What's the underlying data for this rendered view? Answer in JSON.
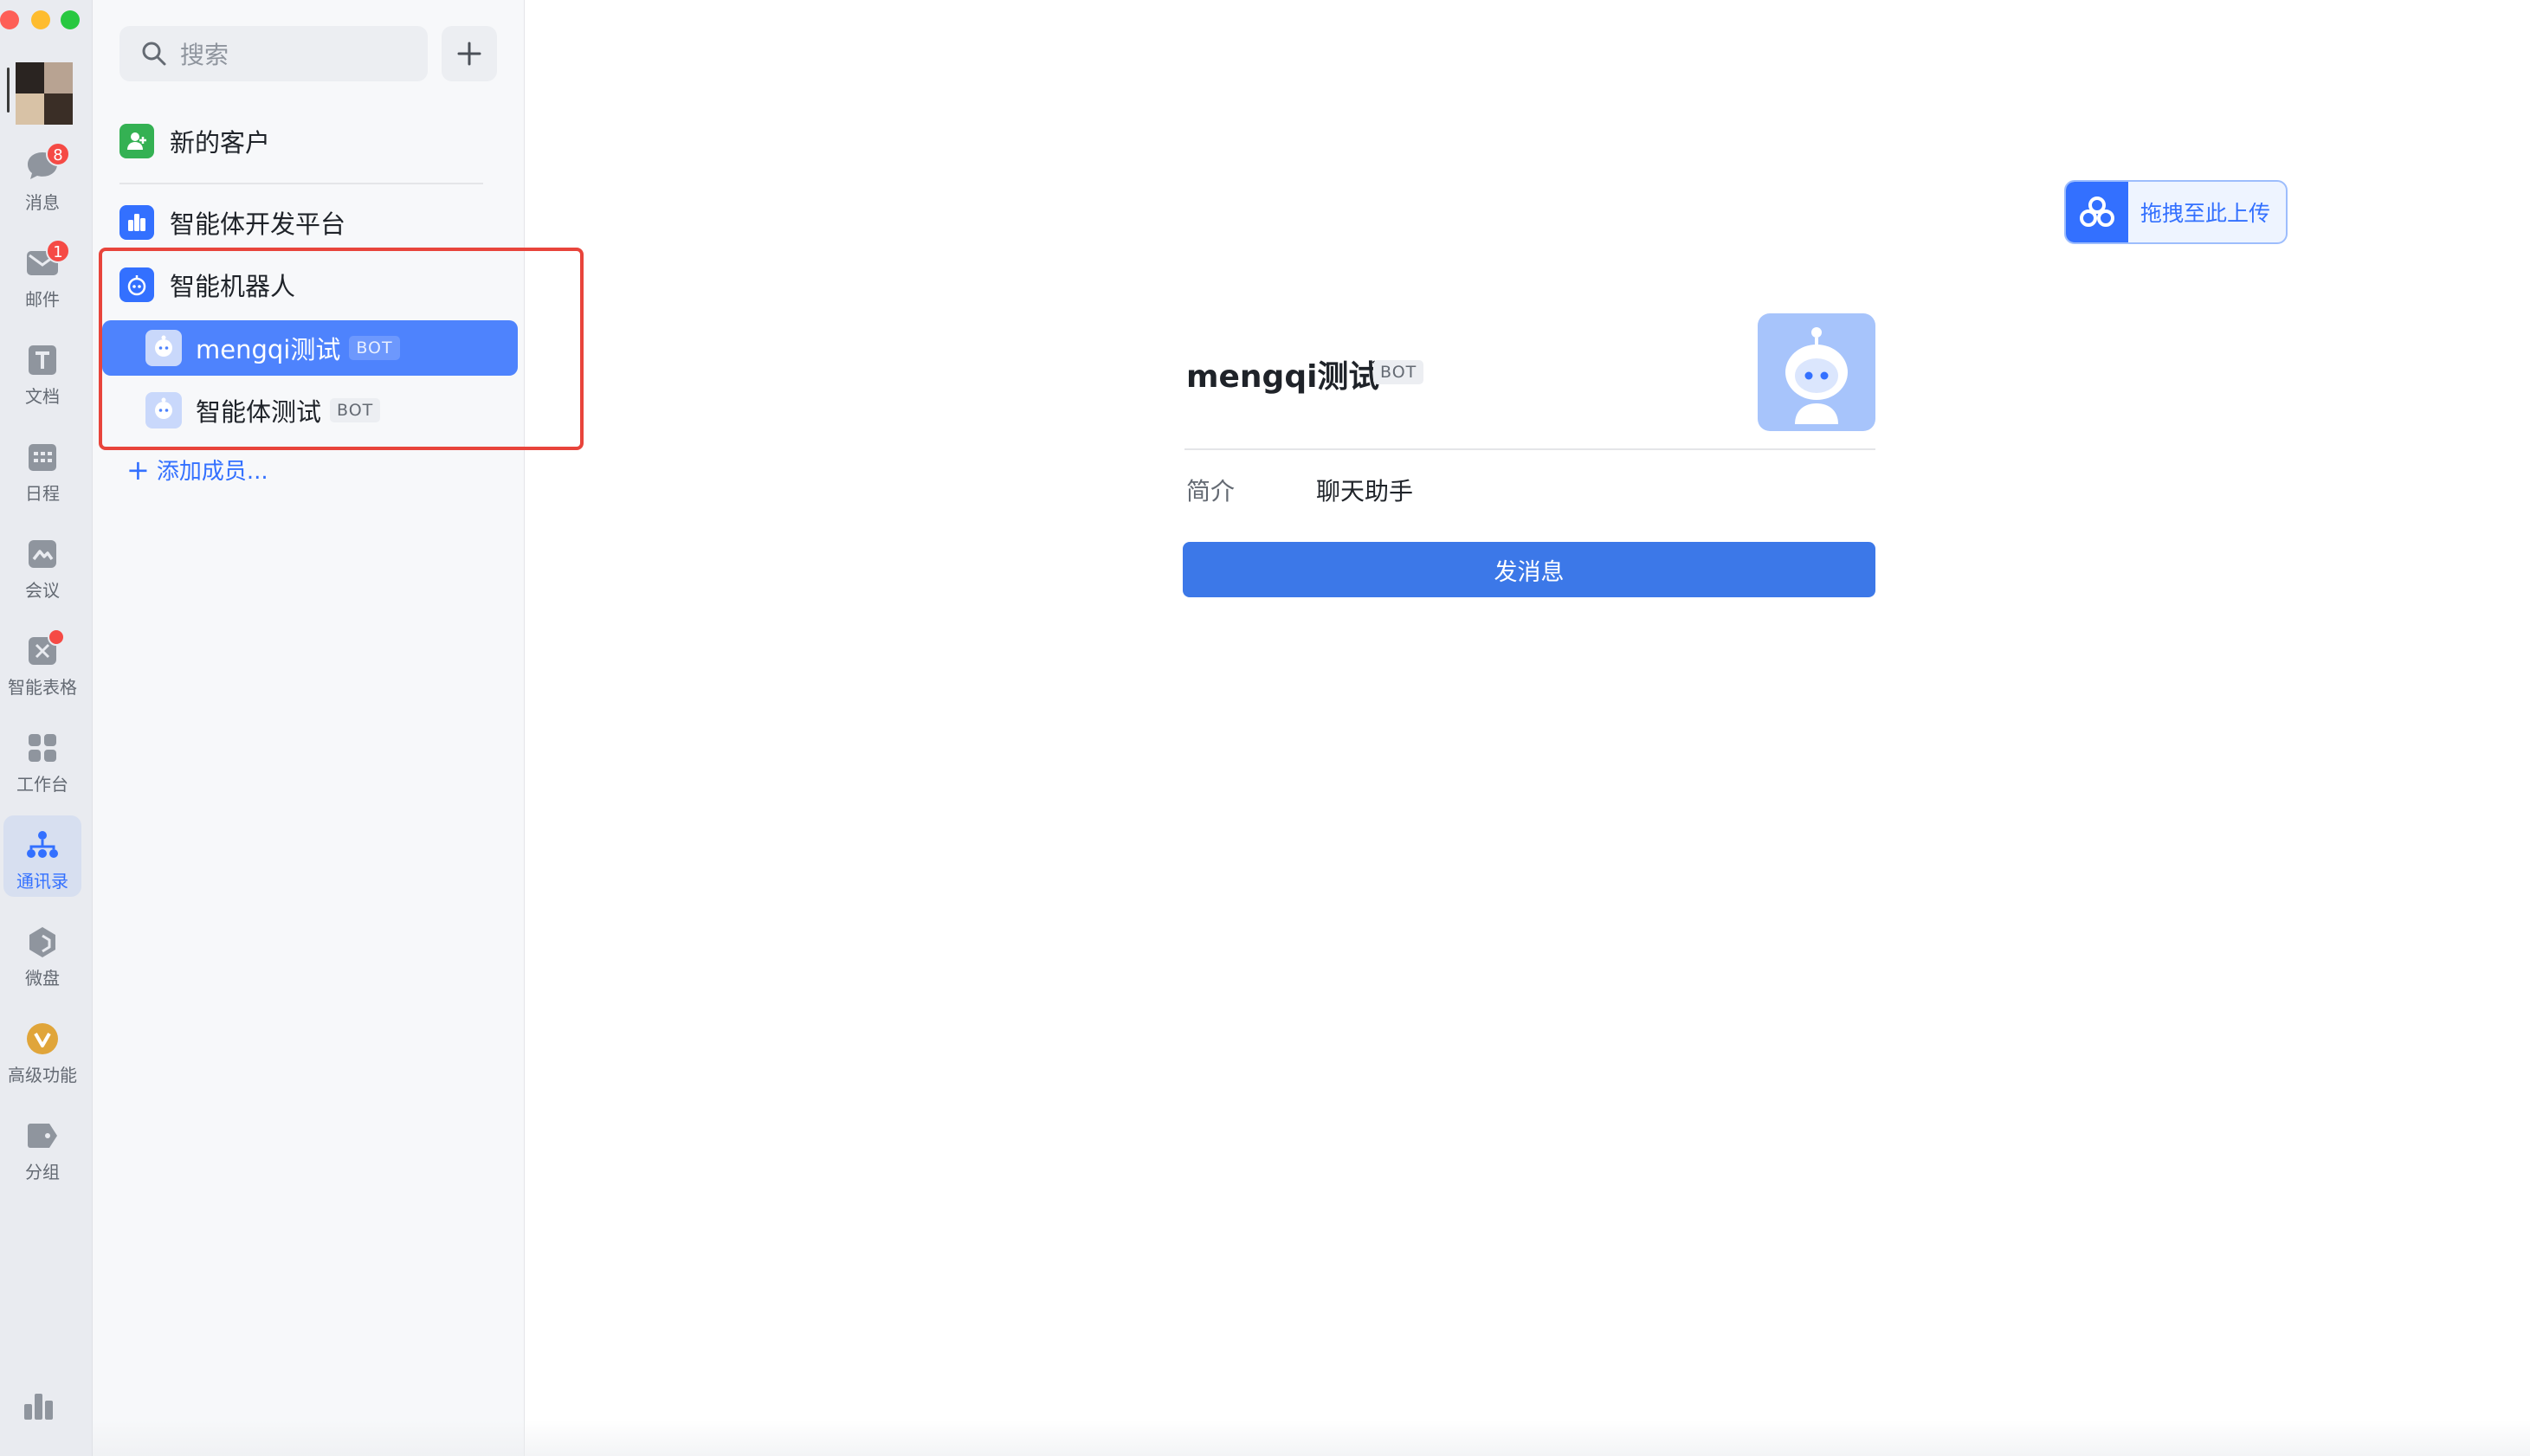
{
  "rail": {
    "items": [
      {
        "id": "messages",
        "label": "消息",
        "badge": "8",
        "icon": "chat-bubble-icon"
      },
      {
        "id": "mail",
        "label": "邮件",
        "badge": "1",
        "icon": "mail-icon"
      },
      {
        "id": "docs",
        "label": "文档",
        "icon": "document-icon"
      },
      {
        "id": "calendar",
        "label": "日程",
        "icon": "calendar-icon"
      },
      {
        "id": "meeting",
        "label": "会议",
        "icon": "meeting-icon"
      },
      {
        "id": "smart-sheet",
        "label": "智能表格",
        "icon": "smart-sheet-icon"
      },
      {
        "id": "workbench",
        "label": "工作台",
        "icon": "grid-icon"
      },
      {
        "id": "contacts",
        "label": "通讯录",
        "icon": "org-chart-icon",
        "active": true
      },
      {
        "id": "drive",
        "label": "微盘",
        "icon": "drive-icon"
      },
      {
        "id": "premium",
        "label": "高级功能",
        "icon": "premium-icon"
      },
      {
        "id": "groups",
        "label": "分组",
        "icon": "tag-icon"
      }
    ]
  },
  "panel": {
    "search_placeholder": "搜索",
    "new_customer": "新的客户",
    "dev_platform": "智能体开发平台",
    "smart_robot": "智能机器人",
    "members": [
      {
        "name": "mengqi测试",
        "tag": "BOT",
        "selected": true
      },
      {
        "name": "智能体测试",
        "tag": "BOT",
        "selected": false
      }
    ],
    "add_member": "添加成员..."
  },
  "detail": {
    "upload_label": "拖拽至此上传",
    "name": "mengqi测试",
    "tag": "BOT",
    "intro_label": "简介",
    "intro_value": "聊天助手",
    "send_label": "发消息"
  },
  "colors": {
    "accent": "#3370ff",
    "selected_row": "#4e83fd",
    "send_button": "#3c78e8",
    "badge": "#f54a45",
    "highlight_box": "#e8443b"
  }
}
